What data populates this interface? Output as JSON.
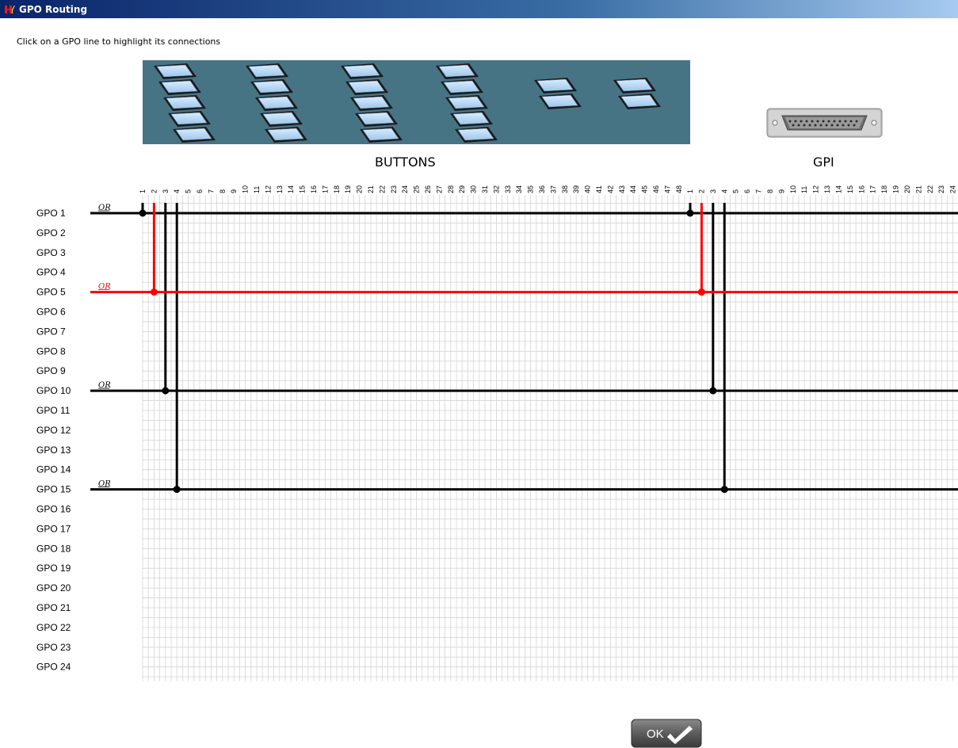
{
  "window": {
    "title": "GPO Routing",
    "app_icon": "app-logo-icon"
  },
  "instruction": "Click on a GPO line to highlight its connections",
  "sections": {
    "buttons_label": "BUTTONS",
    "gpi_label": "GPI"
  },
  "button_columns": [
    "1",
    "2",
    "3",
    "4",
    "5",
    "6",
    "7",
    "8",
    "9",
    "10",
    "11",
    "12",
    "13",
    "14",
    "15",
    "16",
    "17",
    "18",
    "19",
    "20",
    "21",
    "22",
    "23",
    "24",
    "25",
    "26",
    "27",
    "28",
    "29",
    "30",
    "31",
    "32",
    "33",
    "34",
    "35",
    "36",
    "37",
    "38",
    "39",
    "40",
    "41",
    "42",
    "43",
    "44",
    "45",
    "46",
    "47",
    "48"
  ],
  "gpi_columns": [
    "1",
    "2",
    "3",
    "4",
    "5",
    "6",
    "7",
    "8",
    "9",
    "10",
    "11",
    "12",
    "13",
    "14",
    "15",
    "16",
    "17",
    "18",
    "19",
    "20",
    "21",
    "22",
    "23",
    "24"
  ],
  "gpo_rows": [
    "GPO 1",
    "GPO 2",
    "GPO 3",
    "GPO 4",
    "GPO 5",
    "GPO 6",
    "GPO 7",
    "GPO 8",
    "GPO 9",
    "GPO 10",
    "GPO 11",
    "GPO 12",
    "GPO 13",
    "GPO 14",
    "GPO 15",
    "GPO 16",
    "GPO 17",
    "GPO 18",
    "GPO 19",
    "GPO 20",
    "GPO 21",
    "GPO 22",
    "GPO 23",
    "GPO 24"
  ],
  "connections": [
    {
      "gpo": 1,
      "label": "OR",
      "button": 1,
      "gpi": 1,
      "highlighted": false
    },
    {
      "gpo": 5,
      "label": "OR",
      "button": 2,
      "gpi": 2,
      "highlighted": true
    },
    {
      "gpo": 10,
      "label": "OR",
      "button": 3,
      "gpi": 3,
      "highlighted": false
    },
    {
      "gpo": 15,
      "label": "OR",
      "button": 4,
      "gpi": 4,
      "highlighted": false
    }
  ],
  "colors": {
    "normal_line": "#000000",
    "highlight_line": "#ff0000",
    "grid": "#d4d4d4",
    "panel_bg": "#467485"
  },
  "ok_button": {
    "label": "OK",
    "icon": "check-icon"
  }
}
